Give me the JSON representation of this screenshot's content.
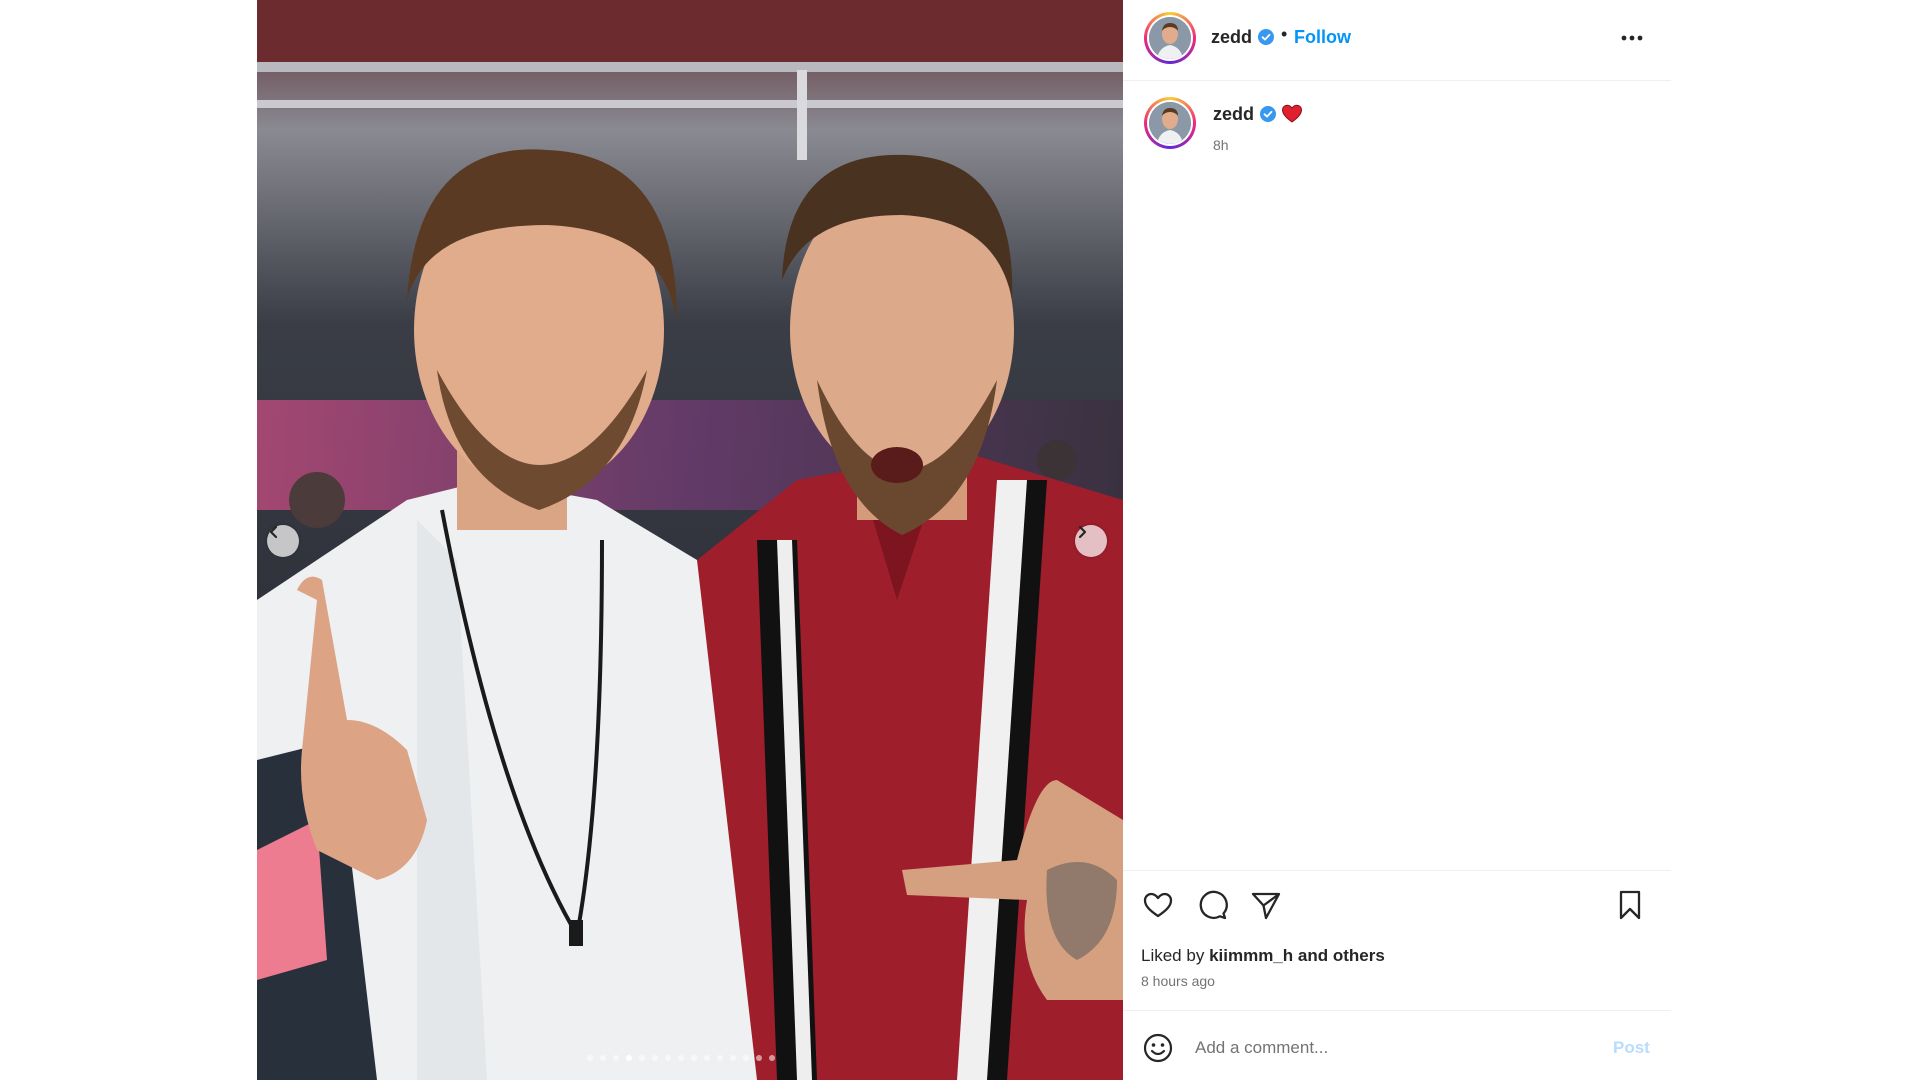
{
  "post": {
    "carousel": {
      "prev_icon": "chevron-left-icon",
      "next_icon": "chevron-right-icon",
      "slide_count": 15,
      "active_slide": 4
    },
    "header": {
      "username": "zedd",
      "verified": true,
      "separator": "•",
      "follow_label": "Follow",
      "more_icon": "more-horizontal-icon"
    },
    "caption": {
      "username": "zedd",
      "verified": true,
      "emoji": "❤️",
      "time": "8h"
    },
    "actions": {
      "like_icon": "heart-icon",
      "comment_icon": "comment-icon",
      "share_icon": "send-icon",
      "save_icon": "bookmark-icon"
    },
    "likes": {
      "prefix": "Liked by",
      "user": "kiimmm_h",
      "suffix": "and others"
    },
    "timestamp": "8 hours ago",
    "comment_box": {
      "emoji_icon": "smiley-icon",
      "placeholder": "Add a comment...",
      "post_label": "Post"
    }
  },
  "colors": {
    "accent": "#0095f6",
    "post_disabled": "#b8dcfb",
    "verified": "#3897f0"
  }
}
